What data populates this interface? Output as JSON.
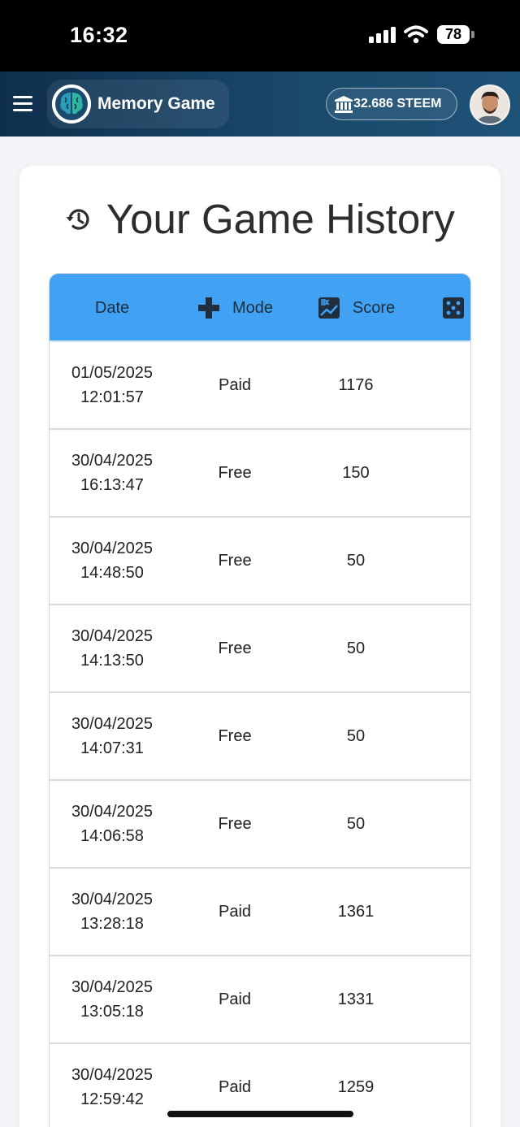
{
  "status_bar": {
    "time": "16:32",
    "battery": "78"
  },
  "header": {
    "app_name": "Memory Game",
    "balance": "32.686 STEEM",
    "menu_icon": "hamburger-menu-icon",
    "balance_icon": "bank-icon"
  },
  "page": {
    "title": "Your Game History",
    "title_icon": "history-icon"
  },
  "table": {
    "columns": [
      {
        "label": "Date",
        "icon": ""
      },
      {
        "label": "Mode",
        "icon": "gamepad-icon"
      },
      {
        "label": "Score",
        "icon": "score-chart-icon"
      },
      {
        "label": "",
        "icon": "dice-icon"
      }
    ],
    "rows": [
      {
        "date": "01/05/2025",
        "time": "12:01:57",
        "mode": "Paid",
        "score": "1176"
      },
      {
        "date": "30/04/2025",
        "time": "16:13:47",
        "mode": "Free",
        "score": "150"
      },
      {
        "date": "30/04/2025",
        "time": "14:48:50",
        "mode": "Free",
        "score": "50"
      },
      {
        "date": "30/04/2025",
        "time": "14:13:50",
        "mode": "Free",
        "score": "50"
      },
      {
        "date": "30/04/2025",
        "time": "14:07:31",
        "mode": "Free",
        "score": "50"
      },
      {
        "date": "30/04/2025",
        "time": "14:06:58",
        "mode": "Free",
        "score": "50"
      },
      {
        "date": "30/04/2025",
        "time": "13:28:18",
        "mode": "Paid",
        "score": "1361"
      },
      {
        "date": "30/04/2025",
        "time": "13:05:18",
        "mode": "Paid",
        "score": "1331"
      },
      {
        "date": "30/04/2025",
        "time": "12:59:42",
        "mode": "Paid",
        "score": "1259"
      }
    ]
  },
  "colors": {
    "header_bg": "#15405f",
    "table_header": "#41a2f3",
    "page_bg": "#f3f4f8"
  }
}
